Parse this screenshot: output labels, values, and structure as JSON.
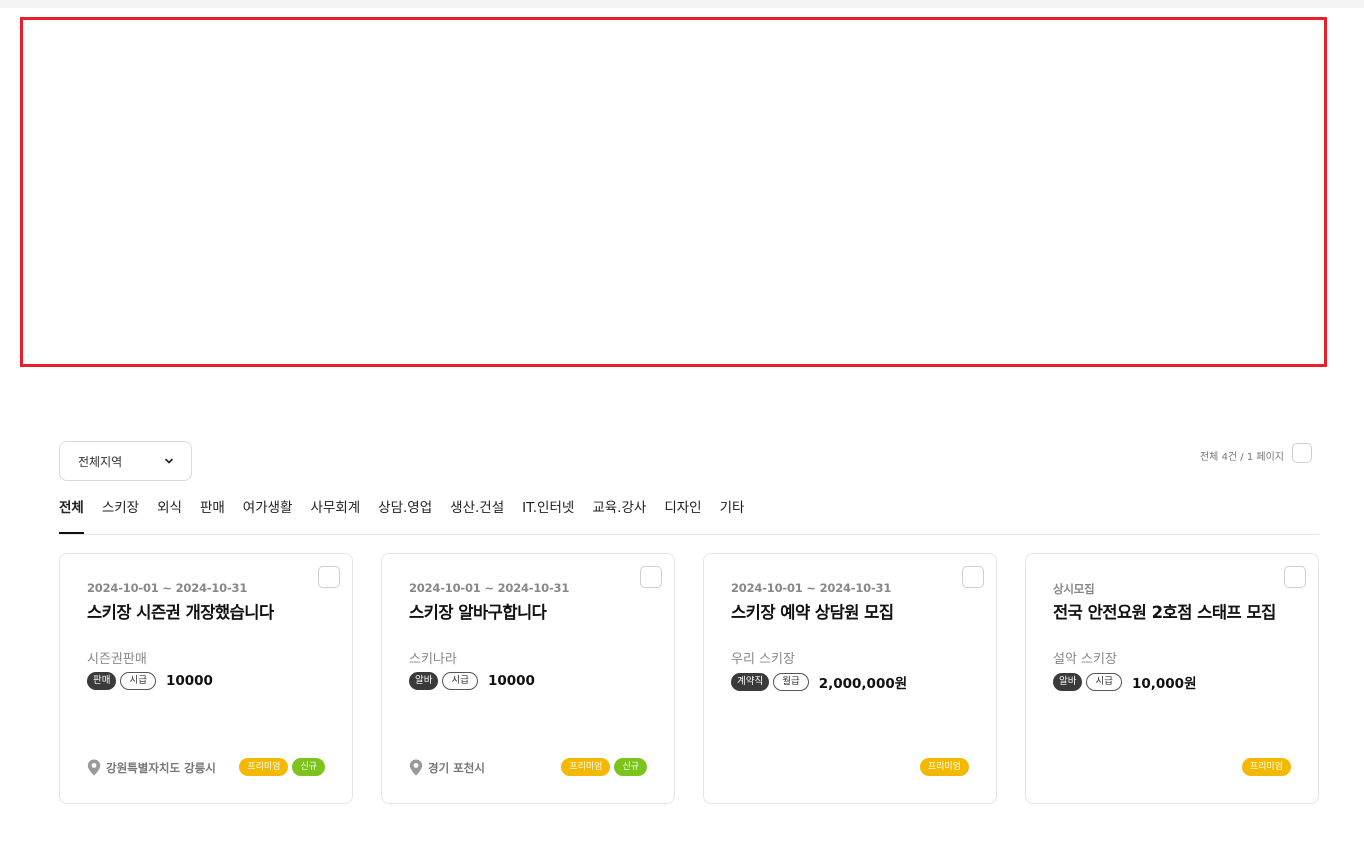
{
  "filters": {
    "region_label": "전체지역",
    "summary": "전체 4건 / 1 페이지"
  },
  "categories": [
    "전체",
    "스키장",
    "외식",
    "판매",
    "여가생활",
    "사무회계",
    "상담.영업",
    "생산.건설",
    "IT.인터넷",
    "교육.강사",
    "디자인",
    "기타"
  ],
  "jobs": [
    {
      "period": "2024-10-01 ~ 2024-10-31",
      "title": "스키장 시즌권 개장했습니다",
      "company": "시즌권판매",
      "type": "판매",
      "pay_unit": "시급",
      "pay": "10000",
      "location": "강원특별자치도 강릉시",
      "badge_premium": "프리미엄",
      "badge_new": "신규"
    },
    {
      "period": "2024-10-01 ~ 2024-10-31",
      "title": "스키장 알바구합니다",
      "company": "스키나라",
      "type": "알바",
      "pay_unit": "시급",
      "pay": "10000",
      "location": "경기 포천시",
      "badge_premium": "프리미엄",
      "badge_new": "신규"
    },
    {
      "period": "2024-10-01 ~ 2024-10-31",
      "title": "스키장 예약 상담원 모집",
      "company": "우리 스키장",
      "type": "계약직",
      "pay_unit": "월급",
      "pay": "2,000,000원",
      "badge_premium": "프리미엄"
    },
    {
      "period": "상시모집",
      "title": "전국 안전요원 2호점 스태프 모집",
      "company": "설악 스키장",
      "type": "알바",
      "pay_unit": "시급",
      "pay": "10,000원",
      "badge_premium": "프리미엄"
    }
  ],
  "colors": {
    "banner_border": "#e8202a",
    "premium": "#f5b800",
    "new": "#7cc31c"
  }
}
